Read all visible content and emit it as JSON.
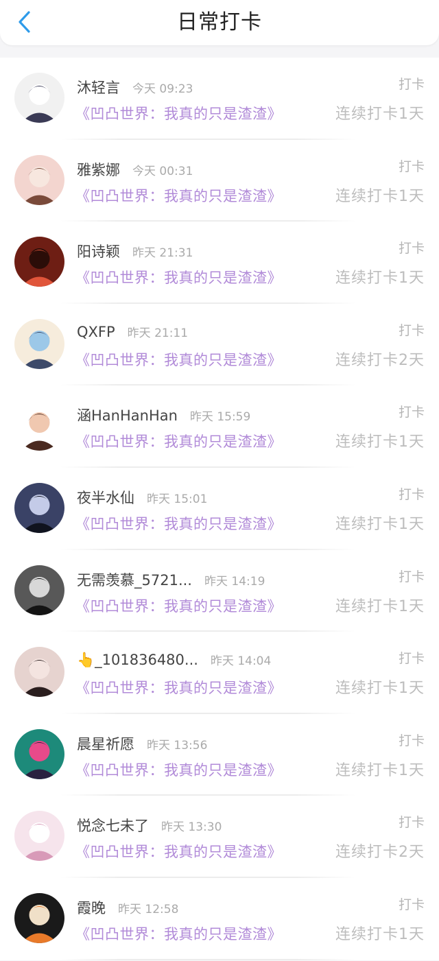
{
  "header": {
    "title": "日常打卡",
    "back_icon": "chevron-left-icon",
    "accent_color": "#2e9bea"
  },
  "colors": {
    "book_title": "#b18ad8",
    "name": "#444444",
    "muted": "#aaaaaa"
  },
  "items": [
    {
      "name": "沐轻言",
      "time": "今天 09:23",
      "book": "《凹凸世界：我真的只是渣渣》",
      "action": "打卡",
      "streak": "连续打卡1天",
      "avatar": {
        "bg": "#f1f1f1",
        "fg": "#3a3a55",
        "accent": "#ffffff"
      }
    },
    {
      "name": "雅紫娜",
      "time": "今天 00:31",
      "book": "《凹凸世界：我真的只是渣渣》",
      "action": "打卡",
      "streak": "连续打卡1天",
      "avatar": {
        "bg": "#f3d5cf",
        "fg": "#7a4a3a",
        "accent": "#f7e7df"
      }
    },
    {
      "name": "阳诗颖",
      "time": "昨天 21:31",
      "book": "《凹凸世界：我真的只是渣渣》",
      "action": "打卡",
      "streak": "连续打卡1天",
      "avatar": {
        "bg": "#6e1e14",
        "fg": "#e0553a",
        "accent": "#2b0d08"
      }
    },
    {
      "name": "QXFP",
      "time": "昨天 21:11",
      "book": "《凹凸世界：我真的只是渣渣》",
      "action": "打卡",
      "streak": "连续打卡2天",
      "avatar": {
        "bg": "#f6ecdc",
        "fg": "#3d4a6a",
        "accent": "#9cc8e8"
      }
    },
    {
      "name": "涵HanHanHan",
      "time": "昨天 15:59",
      "book": "《凹凸世界：我真的只是渣渣》",
      "action": "打卡",
      "streak": "连续打卡1天",
      "avatar": {
        "bg": "#ffffff",
        "fg": "#4a2a20",
        "accent": "#f0c8b0"
      }
    },
    {
      "name": "夜半水仙",
      "time": "昨天 15:01",
      "book": "《凹凸世界：我真的只是渣渣》",
      "action": "打卡",
      "streak": "连续打卡1天",
      "avatar": {
        "bg": "#3a4266",
        "fg": "#10131f",
        "accent": "#c4cbe8"
      }
    },
    {
      "name": "无需羡慕_5721...",
      "time": "昨天 14:19",
      "book": "《凹凸世界：我真的只是渣渣》",
      "action": "打卡",
      "streak": "连续打卡1天",
      "avatar": {
        "bg": "#585858",
        "fg": "#141414",
        "accent": "#d8d8d8"
      }
    },
    {
      "name": "👆_101836480...",
      "time": "昨天 14:04",
      "book": "《凹凸世界：我真的只是渣渣》",
      "action": "打卡",
      "streak": "连续打卡1天",
      "avatar": {
        "bg": "#e6d3cf",
        "fg": "#2a1e1e",
        "accent": "#f4e4e0"
      }
    },
    {
      "name": "晨星祈愿",
      "time": "昨天 13:56",
      "book": "《凹凸世界：我真的只是渣渣》",
      "action": "打卡",
      "streak": "连续打卡1天",
      "avatar": {
        "bg": "#1d8a7a",
        "fg": "#2a2140",
        "accent": "#e84a8a"
      }
    },
    {
      "name": "悦念七未了",
      "time": "昨天 13:30",
      "book": "《凹凸世界：我真的只是渣渣》",
      "action": "打卡",
      "streak": "连续打卡2天",
      "avatar": {
        "bg": "#f6e4ec",
        "fg": "#d89ab8",
        "accent": "#ffffff"
      }
    },
    {
      "name": "霞晚",
      "time": "昨天 12:58",
      "book": "《凹凸世界：我真的只是渣渣》",
      "action": "打卡",
      "streak": "连续打卡1天",
      "avatar": {
        "bg": "#1a1a1a",
        "fg": "#e87a2a",
        "accent": "#f0e0c8"
      }
    }
  ]
}
